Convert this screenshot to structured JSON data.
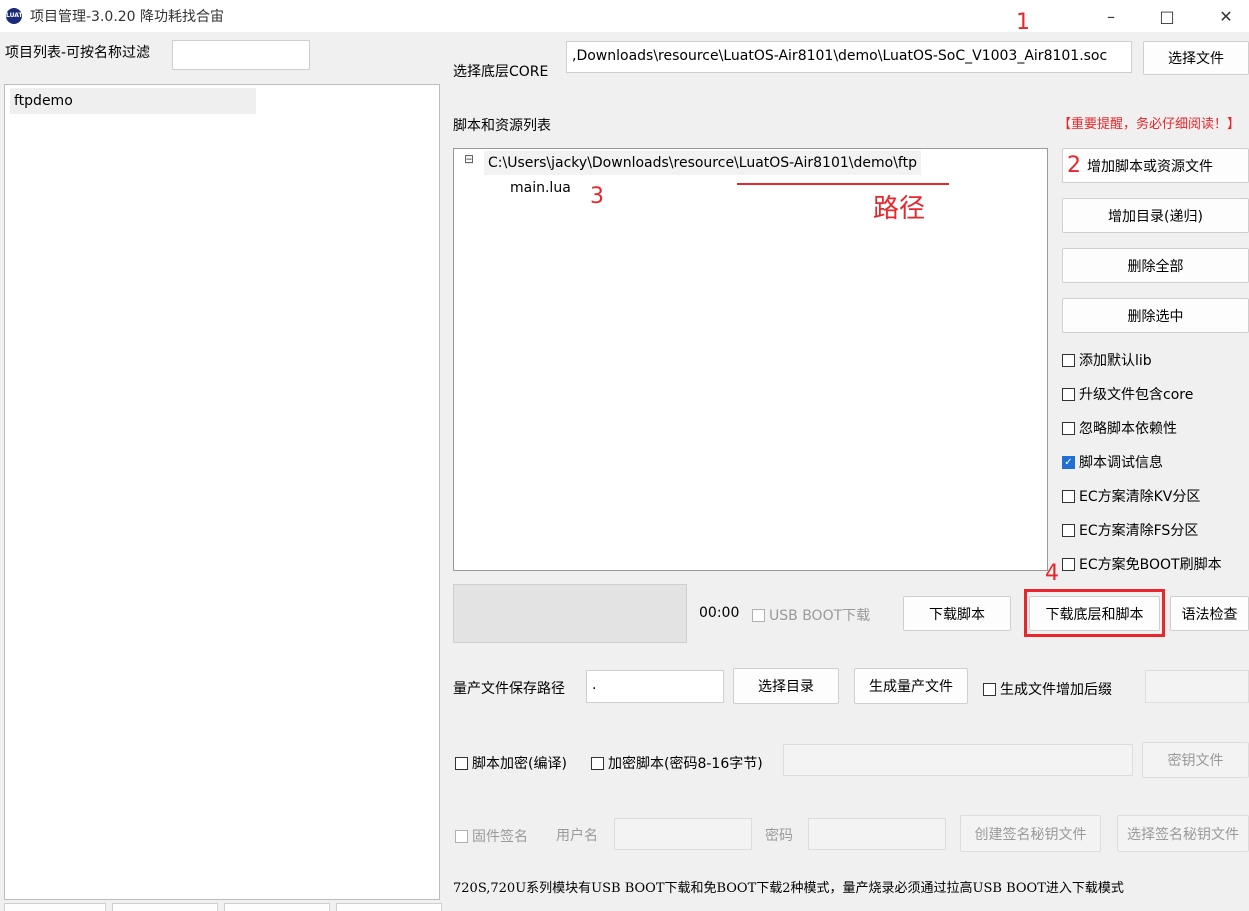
{
  "window": {
    "title": "项目管理-3.0.20 降功耗找合宙",
    "logo_text": "LUAT",
    "min_icon": "–",
    "max_icon": "□",
    "close_icon": "✕"
  },
  "left_panel": {
    "filter_label": "项目列表-可按名称过滤",
    "filter_value": "",
    "projects": [
      "ftpdemo"
    ]
  },
  "core": {
    "label": "选择底层CORE",
    "path": ",Downloads\\resource\\LuatOS-Air8101\\demo\\LuatOS-SoC_V1003_Air8101.soc",
    "select_button": "选择文件"
  },
  "scripts": {
    "label": "脚本和资源列表",
    "important_notice": "【重要提醒，务必仔细阅读！】",
    "tree": {
      "expander": "⊟",
      "folder": "C:\\Users\\jacky\\Downloads\\resource\\LuatOS-Air8101\\demo\\ftp",
      "files": [
        "main.lua"
      ]
    }
  },
  "side_buttons": {
    "add_script": "增加脚本或资源文件",
    "add_dir": "增加目录(递归)",
    "delete_all": "删除全部",
    "delete_selected": "删除选中"
  },
  "options": [
    {
      "label": "添加默认lib",
      "checked": false
    },
    {
      "label": "升级文件包含core",
      "checked": false
    },
    {
      "label": "忽略脚本依赖性",
      "checked": false
    },
    {
      "label": "脚本调试信息",
      "checked": true
    },
    {
      "label": "EC方案清除KV分区",
      "checked": false
    },
    {
      "label": "EC方案清除FS分区",
      "checked": false
    },
    {
      "label": "EC方案免BOOT刷脚本",
      "checked": false
    }
  ],
  "download": {
    "timer": "00:00",
    "usb_boot_label": "USB BOOT下载",
    "download_script": "下载脚本",
    "download_core_and_script": "下载底层和脚本",
    "syntax_check": "语法检查"
  },
  "mass_production": {
    "path_label": "量产文件保存路径",
    "path_value": ".",
    "select_dir": "选择目录",
    "generate": "生成量产文件",
    "suffix_label": "生成文件增加后缀"
  },
  "encryption": {
    "encrypt_label": "脚本加密(编译)",
    "encrypt_key_label": "加密脚本(密码8-16字节)",
    "key_file_button": "密钥文件"
  },
  "signing": {
    "firmware_sign_label": "固件签名",
    "username_label": "用户名",
    "password_label": "密码",
    "create_key": "创建签名秘钥文件",
    "select_key": "选择签名秘钥文件"
  },
  "footer_note": "720S,720U系列模块有USB BOOT下载和免BOOT下载2种模式，量产烧录必须通过拉高USB BOOT进入下载模式",
  "annotations": {
    "n1": "1",
    "n2": "2",
    "n3": "3",
    "n4": "4",
    "path_note": "路径"
  },
  "colors": {
    "annotation_red": "#e8262b",
    "checkbox_blue": "#1f6fd6"
  }
}
